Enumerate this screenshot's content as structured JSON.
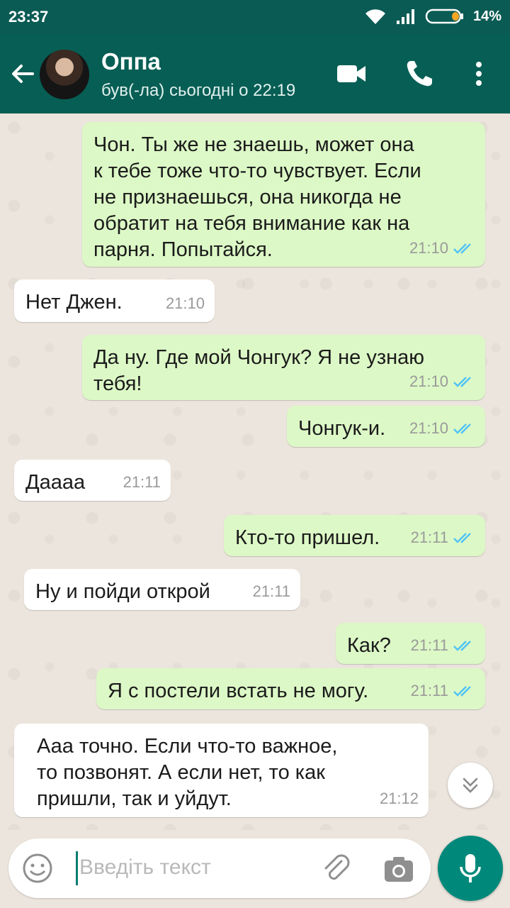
{
  "status_bar": {
    "time": "23:37",
    "battery_percent": "14%"
  },
  "header": {
    "contact_name": "Оппа",
    "last_seen": "був(-ла) сьогодні о 22:19"
  },
  "messages": [
    {
      "dir": "out",
      "text": "Чон. Ты же не знаешь, может она\nк тебе тоже что-то чувствует. Если\nне признаешься, она никогда не\nобратит на тебя внимание как на\nпарня. Попытайся.",
      "time": "21:10"
    },
    {
      "dir": "in",
      "text": "Нет Джен.",
      "time": "21:10"
    },
    {
      "dir": "out",
      "text": "Да ну. Где мой Чонгук? Я не узнаю\nтебя!",
      "time": "21:10"
    },
    {
      "dir": "out",
      "text": "Чонгук-и.",
      "time": "21:10"
    },
    {
      "dir": "in",
      "text": "Даааа",
      "time": "21:11"
    },
    {
      "dir": "out",
      "text": "Кто-то пришел.",
      "time": "21:11"
    },
    {
      "dir": "in",
      "text": "Ну и пойди открой",
      "time": "21:11"
    },
    {
      "dir": "out",
      "text": "Как?",
      "time": "21:11"
    },
    {
      "dir": "out",
      "text": "Я с постели встать не могу.",
      "time": "21:11"
    },
    {
      "dir": "in",
      "text": "Ааа точно. Если что-то важное,\nто позвонят. А если нет, то как\nпришли, так и уйдут.",
      "time": "21:12"
    }
  ],
  "input": {
    "placeholder": "Введіть текст"
  },
  "colors": {
    "header": "#075e54",
    "outgoing": "#dcf8c6",
    "incoming": "#ffffff",
    "read_tick": "#4fc3f7",
    "fab": "#00897b"
  }
}
